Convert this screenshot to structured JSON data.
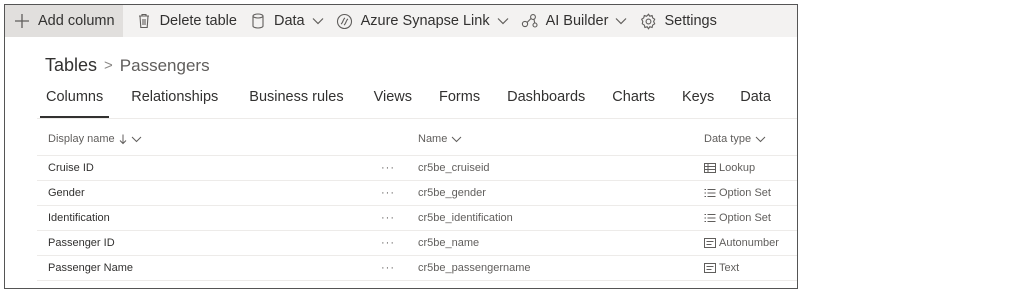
{
  "toolbar": {
    "add_column": "Add column",
    "delete_table": "Delete table",
    "data": "Data",
    "azure_synapse_link": "Azure Synapse Link",
    "ai_builder": "AI Builder",
    "settings": "Settings"
  },
  "breadcrumb": {
    "root": "Tables",
    "separator": ">",
    "current": "Passengers"
  },
  "tabs": [
    {
      "label": "Columns",
      "active": true
    },
    {
      "label": "Relationships"
    },
    {
      "label": "Business rules"
    },
    {
      "label": "Views"
    },
    {
      "label": "Forms"
    },
    {
      "label": "Dashboards"
    },
    {
      "label": "Charts"
    },
    {
      "label": "Keys"
    },
    {
      "label": "Data"
    }
  ],
  "grid": {
    "headers": {
      "display_name": "Display name",
      "name": "Name",
      "data_type": "Data type"
    },
    "more_label": "···",
    "rows": [
      {
        "display_name": "Cruise ID",
        "name": "cr5be_cruiseid",
        "data_type": "Lookup",
        "type_icon": "lookup-icon"
      },
      {
        "display_name": "Gender",
        "name": "cr5be_gender",
        "data_type": "Option Set",
        "type_icon": "option-set-icon"
      },
      {
        "display_name": "Identification",
        "name": "cr5be_identification",
        "data_type": "Option Set",
        "type_icon": "option-set-icon"
      },
      {
        "display_name": "Passenger ID",
        "name": "cr5be_name",
        "data_type": "Autonumber",
        "type_icon": "autonumber-icon"
      },
      {
        "display_name": "Passenger Name",
        "name": "cr5be_passengername",
        "data_type": "Text",
        "type_icon": "text-icon"
      }
    ]
  },
  "colors": {
    "toolbar_bg": "#f3f2f1",
    "toolbar_active_bg": "#e1dfdd",
    "text": "#323130",
    "muted": "#605e5c"
  }
}
